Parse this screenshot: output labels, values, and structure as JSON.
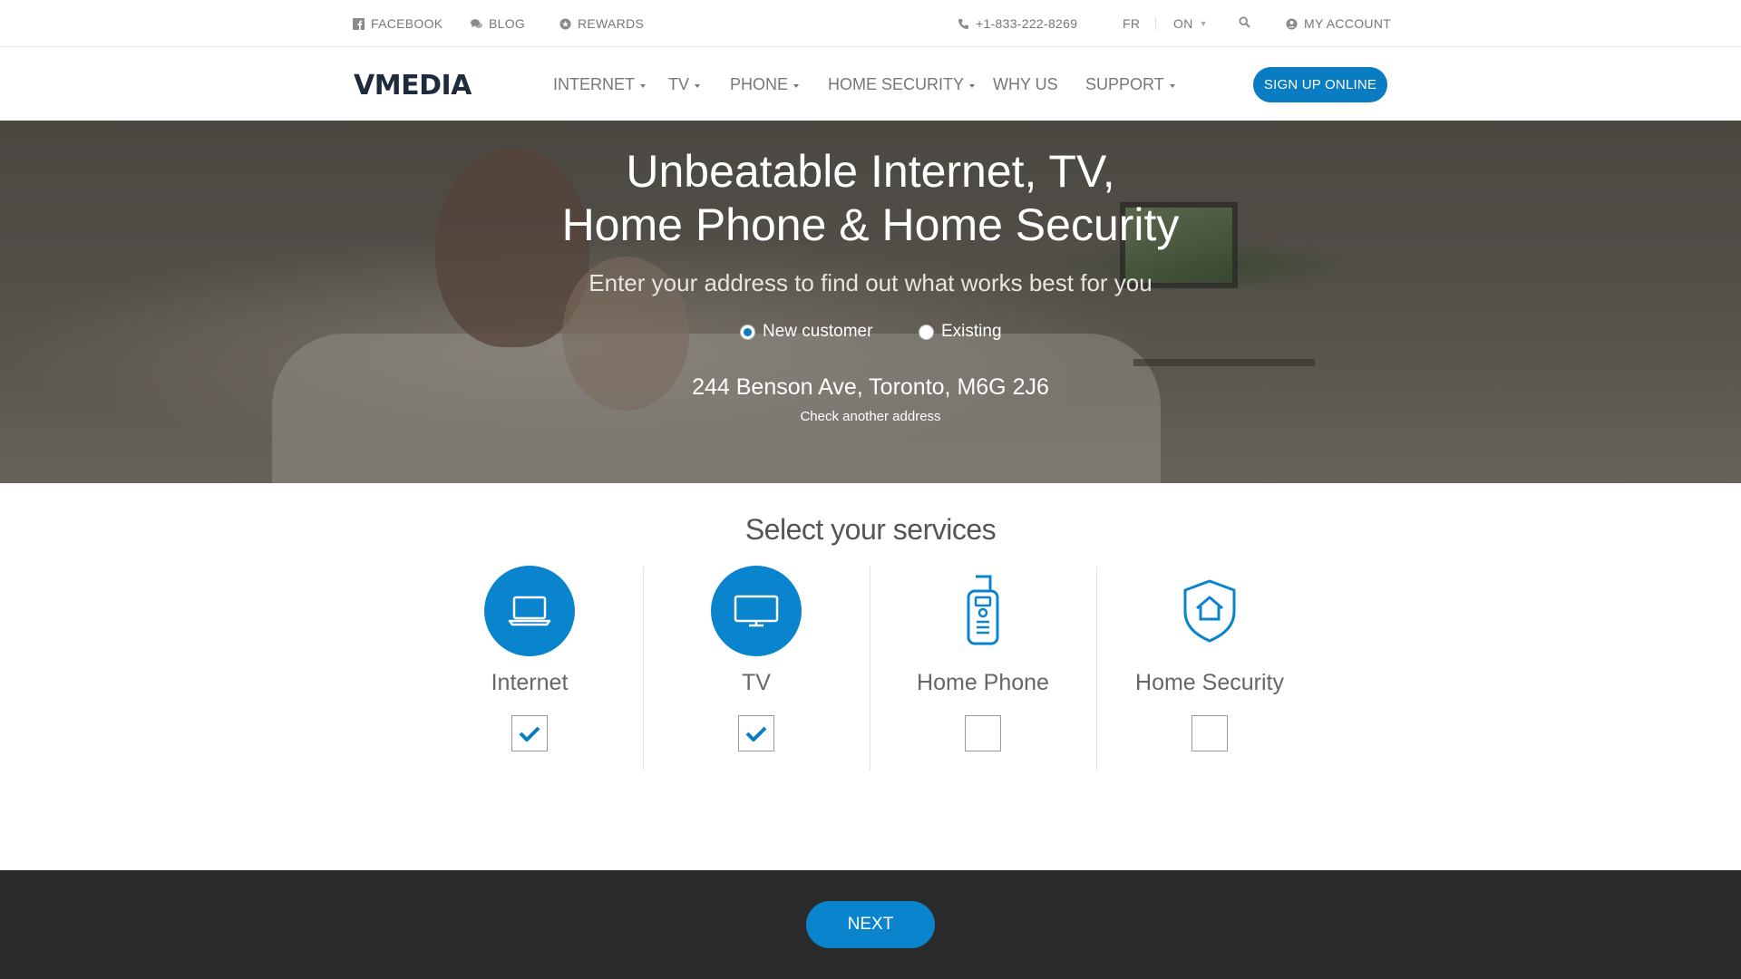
{
  "utility_bar": {
    "facebook": "FACEBOOK",
    "blog": "BLOG",
    "rewards": "REWARDS",
    "phone": "+1-833-222-8269",
    "language": "FR",
    "province": "ON",
    "account": "MY ACCOUNT"
  },
  "nav": {
    "logo": "VMEDIA",
    "items": [
      "INTERNET",
      "TV",
      "PHONE",
      "HOME SECURITY",
      "WHY US",
      "SUPPORT"
    ],
    "signup": "SIGN UP ONLINE"
  },
  "hero": {
    "title_line1": "Unbeatable Internet, TV,",
    "title_line2": "Home Phone & Home Security",
    "subtitle": "Enter your address to find out what works best for you",
    "customer_options": [
      {
        "label": "New customer",
        "selected": true
      },
      {
        "label": "Existing",
        "selected": false
      }
    ],
    "address": "244 Benson Ave, Toronto, M6G 2J6",
    "check_link": "Check another address"
  },
  "services": {
    "title": "Select your services",
    "items": [
      {
        "label": "Internet",
        "icon": "laptop-icon",
        "checked": true
      },
      {
        "label": "TV",
        "icon": "tv-icon",
        "checked": true
      },
      {
        "label": "Home Phone",
        "icon": "cordless-phone-icon",
        "checked": false
      },
      {
        "label": "Home Security",
        "icon": "shield-house-icon",
        "checked": false
      }
    ]
  },
  "footer": {
    "next": "NEXT"
  },
  "colors": {
    "accent": "#0a84cc",
    "logo_dark": "#1e2b3c",
    "footer_bg": "#2b2b2b"
  }
}
